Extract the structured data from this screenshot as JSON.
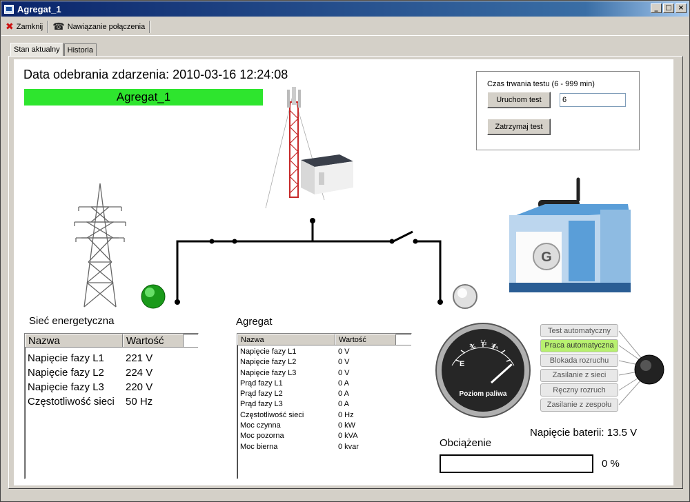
{
  "window": {
    "title": "Agregat_1"
  },
  "toolbar": {
    "close_label": "Zamknij",
    "connect_label": "Nawiązanie połączenia"
  },
  "tabs": [
    {
      "label": "Stan aktualny"
    },
    {
      "label": "Historia"
    }
  ],
  "event": {
    "date_label": "Data odebrania zdarzenia: 2010-03-16 12:24:08"
  },
  "unit": {
    "name": "Agregat_1"
  },
  "test": {
    "duration_label": "Czas trwania testu (6 - 999 min)",
    "start_label": "Uruchom test",
    "stop_label": "Zatrzymaj test",
    "duration_value": "6"
  },
  "grid": {
    "title": "Sieć energetyczna",
    "col_name": "Nazwa",
    "col_value": "Wartość",
    "rows": [
      {
        "name": "Napięcie fazy L1",
        "value": "221 V"
      },
      {
        "name": "Napięcie fazy L2",
        "value": "224 V"
      },
      {
        "name": "Napięcie fazy L3",
        "value": "220 V"
      },
      {
        "name": "Częstotliwość sieci",
        "value": "50 Hz"
      }
    ]
  },
  "generator": {
    "title": "Agregat",
    "col_name": "Nazwa",
    "col_value": "Wartość",
    "rows": [
      {
        "name": "Napięcie fazy L1",
        "value": "0 V"
      },
      {
        "name": "Napięcie fazy L2",
        "value": "0 V"
      },
      {
        "name": "Napięcie fazy L3",
        "value": "0 V"
      },
      {
        "name": "Prąd fazy L1",
        "value": "0 A"
      },
      {
        "name": "Prąd fazy L2",
        "value": "0 A"
      },
      {
        "name": "Prąd fazy L3",
        "value": "0 A"
      },
      {
        "name": "Częstotliwość sieci",
        "value": "0 Hz"
      },
      {
        "name": "Moc czynna",
        "value": "0 kW"
      },
      {
        "name": "Moc pozorna",
        "value": "0 kVA"
      },
      {
        "name": "Moc bierna",
        "value": "0 kvar"
      }
    ]
  },
  "fuel_gauge": {
    "label": "Poziom paliwa",
    "scale": {
      "empty": "E",
      "quarter": "¼",
      "half": "½",
      "three_quarter": "¾"
    },
    "level": 0.9
  },
  "modes": {
    "items": [
      {
        "label": "Test automatyczny",
        "active": false
      },
      {
        "label": "Praca automatyczna",
        "active": true
      },
      {
        "label": "Blokada rozruchu",
        "active": false
      },
      {
        "label": "Zasilanie z sieci",
        "active": false
      },
      {
        "label": "Ręczny rozruch",
        "active": false
      },
      {
        "label": "Zasilanie z zespołu",
        "active": false
      }
    ]
  },
  "battery": {
    "label": "Napięcie baterii: 13.5 V"
  },
  "load": {
    "title": "Obciążenie",
    "percent": 0,
    "percent_label": "0 %"
  },
  "indicators": {
    "grid_color": "#22cc22",
    "generator_color": "#e0e0e0"
  },
  "colors": {
    "accent_green": "#2ee52e",
    "title_blue": "#0a246a"
  },
  "generator_logo": {
    "letter": "G"
  }
}
